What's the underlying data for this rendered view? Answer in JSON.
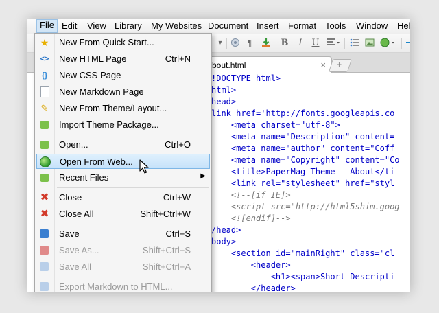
{
  "menubar": [
    "File",
    "Edit",
    "View",
    "Library",
    "My Websites",
    "Document",
    "Insert",
    "Format",
    "Tools",
    "Window",
    "Help"
  ],
  "tab": {
    "label": "bout.html",
    "close": "×",
    "new_tab": "+"
  },
  "toolbar": {
    "bold": "B",
    "italic": "I",
    "underline": "U",
    "pilcrow": "¶",
    "dropdown": "▾"
  },
  "code_lines": [
    "!DOCTYPE html>",
    "html>",
    "head>",
    "link href='http://fonts.googleapis.co",
    "    <meta charset=\"utf-8\">",
    "    <meta name=\"Description\" content=",
    "    <meta name=\"author\" content=\"Coff",
    "    <meta name=\"Copyright\" content=\"Co",
    "    <title>PaperMag Theme - About</ti",
    "    <link rel=\"stylesheet\" href=\"styl",
    "    <!--[if IE]>",
    "    <script src=\"http://html5shim.goog",
    "    <![endif]-->",
    "/head>",
    "body>",
    "    <section id=\"mainRight\" class=\"cl",
    "        <header>",
    "            <h1><span>Short Descripti",
    "        </header>"
  ],
  "menu": {
    "items": [
      {
        "label": "New From Quick Start...",
        "shortcut": "",
        "icon": "star-icon"
      },
      {
        "label": "New HTML Page",
        "shortcut": "Ctrl+N",
        "icon": "html-icon"
      },
      {
        "label": "New CSS Page",
        "shortcut": "",
        "icon": "css-icon"
      },
      {
        "label": "New Markdown Page",
        "shortcut": "",
        "icon": "page-icon"
      },
      {
        "label": "New From Theme/Layout...",
        "shortcut": "",
        "icon": "pen-icon"
      },
      {
        "label": "Import Theme Package...",
        "shortcut": "",
        "icon": "import-icon"
      },
      {
        "label": "Open...",
        "shortcut": "Ctrl+O",
        "icon": "open-icon"
      },
      {
        "label": "Open From Web...",
        "shortcut": "",
        "icon": "globe-icon"
      },
      {
        "label": "Recent Files",
        "shortcut": "",
        "icon": "recent-icon"
      },
      {
        "label": "Close",
        "shortcut": "Ctrl+W",
        "icon": "close-icon"
      },
      {
        "label": "Close All",
        "shortcut": "Shift+Ctrl+W",
        "icon": "close-all-icon"
      },
      {
        "label": "Save",
        "shortcut": "Ctrl+S",
        "icon": "save-icon"
      },
      {
        "label": "Save As...",
        "shortcut": "Shift+Ctrl+S",
        "icon": "save-as-icon"
      },
      {
        "label": "Save All",
        "shortcut": "Shift+Ctrl+A",
        "icon": "save-all-icon"
      },
      {
        "label": "Export Markdown to HTML...",
        "shortcut": "",
        "icon": "export-icon"
      }
    ],
    "submenu_arrow": "▶"
  }
}
